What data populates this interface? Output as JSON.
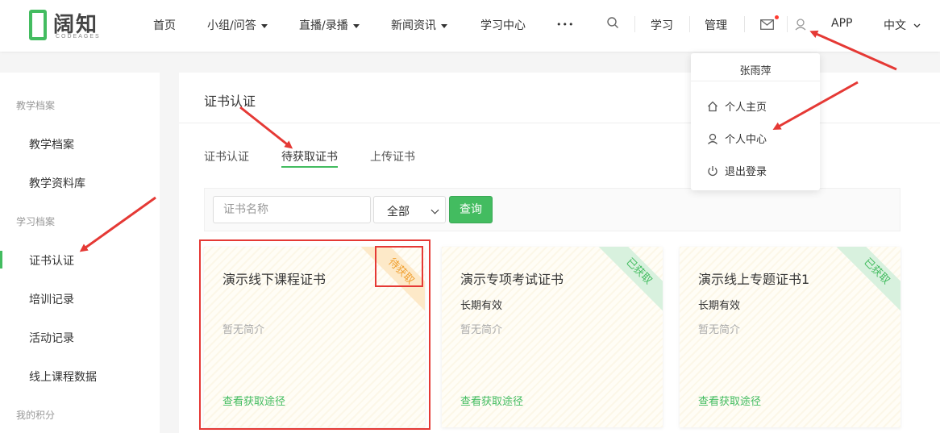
{
  "brand": {
    "name": "阔知",
    "subtitle": "CODEAGES"
  },
  "nav": {
    "home": "首页",
    "groups": "小组/问答",
    "live": "直播/录播",
    "news": "新闻资讯",
    "learning_center": "学习中心",
    "more": "•••",
    "study": "学习",
    "manage": "管理",
    "app": "APP",
    "lang": "中文"
  },
  "sidebar": {
    "group_teaching": "教学档案",
    "teaching_archive": "教学档案",
    "teaching_materials": "教学资料库",
    "group_learning": "学习档案",
    "certificates": "证书认证",
    "training": "培训记录",
    "activities": "活动记录",
    "online_course": "线上课程数据",
    "group_points": "我的积分"
  },
  "main": {
    "title": "证书认证",
    "tabs": [
      "证书认证",
      "待获取证书",
      "上传证书"
    ],
    "filter": {
      "placeholder": "证书名称",
      "select_value": "全部",
      "query": "查询"
    },
    "cards": [
      {
        "title": "演示线下课程证书",
        "validity": "",
        "desc": "暂无简介",
        "link": "查看获取途径",
        "badge": "待获取",
        "badge_color": "#f0a030"
      },
      {
        "title": "演示专项考试证书",
        "validity": "长期有效",
        "desc": "暂无简介",
        "link": "查看获取途径",
        "badge": "已获取",
        "badge_color": "#43bc60"
      },
      {
        "title": "演示线上专题证书1",
        "validity": "长期有效",
        "desc": "暂无简介",
        "link": "查看获取途径",
        "badge": "已获取",
        "badge_color": "#43bc60"
      }
    ]
  },
  "dropdown": {
    "user": "张雨萍",
    "items": [
      "个人主页",
      "个人中心",
      "退出登录"
    ]
  },
  "colors": {
    "accent": "#43bc60",
    "annotation": "#e53935"
  }
}
